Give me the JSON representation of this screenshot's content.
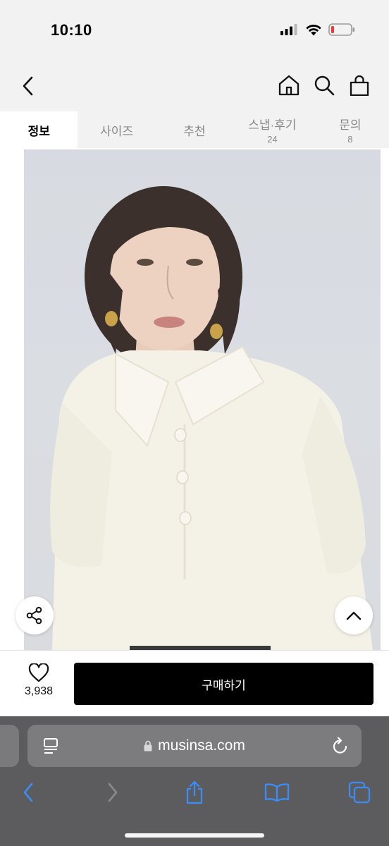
{
  "status_bar": {
    "time": "10:10"
  },
  "tabs": [
    {
      "label": "정보",
      "count": ""
    },
    {
      "label": "사이즈",
      "count": ""
    },
    {
      "label": "추천",
      "count": ""
    },
    {
      "label": "스냅·후기",
      "count": "24"
    },
    {
      "label": "문의",
      "count": "8"
    }
  ],
  "buy_bar": {
    "like_count": "3,938",
    "buy_label": "구매하기"
  },
  "browser": {
    "url": "musinsa.com"
  },
  "colors": {
    "active_tab": "#ffffff",
    "inactive_tab": "#f2f2f2",
    "buy_button": "#000000",
    "safari_bar": "#5c5c5e",
    "safari_accent": "#3c8cf6"
  },
  "icons": [
    "back-icon",
    "home-icon",
    "search-icon",
    "cart-icon",
    "share-icon",
    "chevron-up-icon",
    "heart-icon",
    "reader-icon",
    "lock-icon",
    "reload-icon",
    "safari-back-icon",
    "safari-forward-icon",
    "safari-share-icon",
    "bookmarks-icon",
    "tabs-icon"
  ]
}
